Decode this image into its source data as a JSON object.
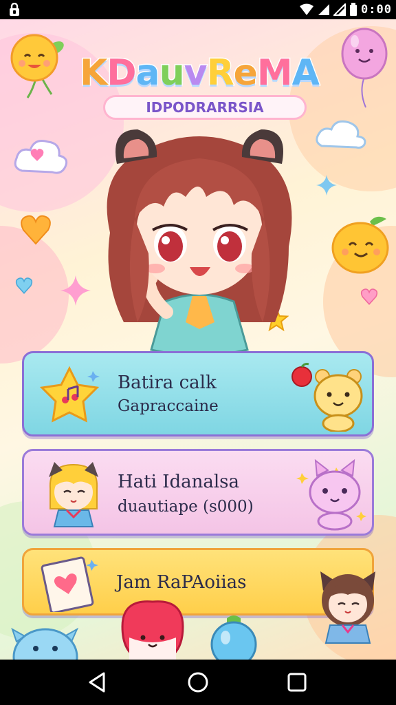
{
  "status_bar": {
    "time": "0:00",
    "icons": [
      "lock-icon",
      "wifi-icon",
      "signal-icon",
      "signal-icon",
      "battery-icon"
    ]
  },
  "logo": {
    "title": "KDauvReMA",
    "subtitle": "IDPODRARRSIA"
  },
  "menu": {
    "card1": {
      "title": "Batira calk",
      "subtitle": "Gapraccaine",
      "icon": "star-note-icon",
      "mascot": "bear-mascot"
    },
    "card2": {
      "title": "Hati Idanalsa",
      "subtitle": "duautiape (s000)",
      "icon": "girl-avatar",
      "mascot": "cat-mascot"
    },
    "card3": {
      "title": "Jam RaPAoiias",
      "icon": "heart-notebook-icon",
      "mascot": "girl-sticker"
    }
  },
  "nav_bar": {
    "buttons": [
      "back-icon",
      "home-icon",
      "recents-icon"
    ]
  },
  "colors": {
    "card1": "#7fd6e3",
    "card2": "#f4c4e6",
    "card3": "#ffcf4a",
    "accent": "#8b6fd6"
  }
}
